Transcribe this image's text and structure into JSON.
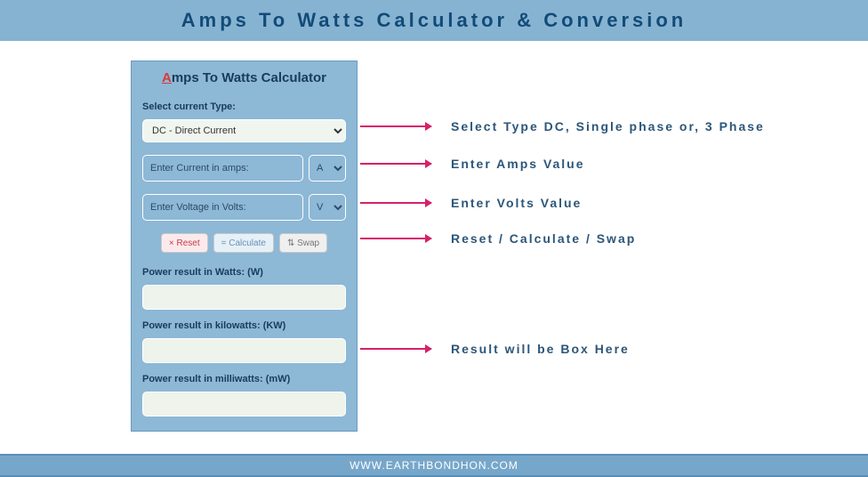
{
  "header": {
    "title": "Amps To Watts Calculator & Conversion"
  },
  "calculator": {
    "title_first": "A",
    "title_rest": "mps To Watts Calculator",
    "current_type_label": "Select current Type:",
    "current_type_value": "DC - Direct Current",
    "current_placeholder": "Enter Current in amps:",
    "current_unit": "A",
    "voltage_placeholder": "Enter Voltage in Volts:",
    "voltage_unit": "V",
    "buttons": {
      "reset": "× Reset",
      "calculate": "= Calculate",
      "swap": "⇅ Swap"
    },
    "result_watts_label": "Power result in Watts: (W)",
    "result_kw_label": "Power result in kilowatts: (KW)",
    "result_mw_label": "Power result in milliwatts: (mW)"
  },
  "annotations": {
    "select_type": "Select Type DC, Single phase or, 3 Phase",
    "enter_amps": "Enter Amps Value",
    "enter_volts": "Enter Volts Value",
    "buttons": "Reset / Calculate / Swap",
    "result": "Result will be Box Here"
  },
  "footer": {
    "url": "WWW.EARTHBONDHON.COM"
  }
}
